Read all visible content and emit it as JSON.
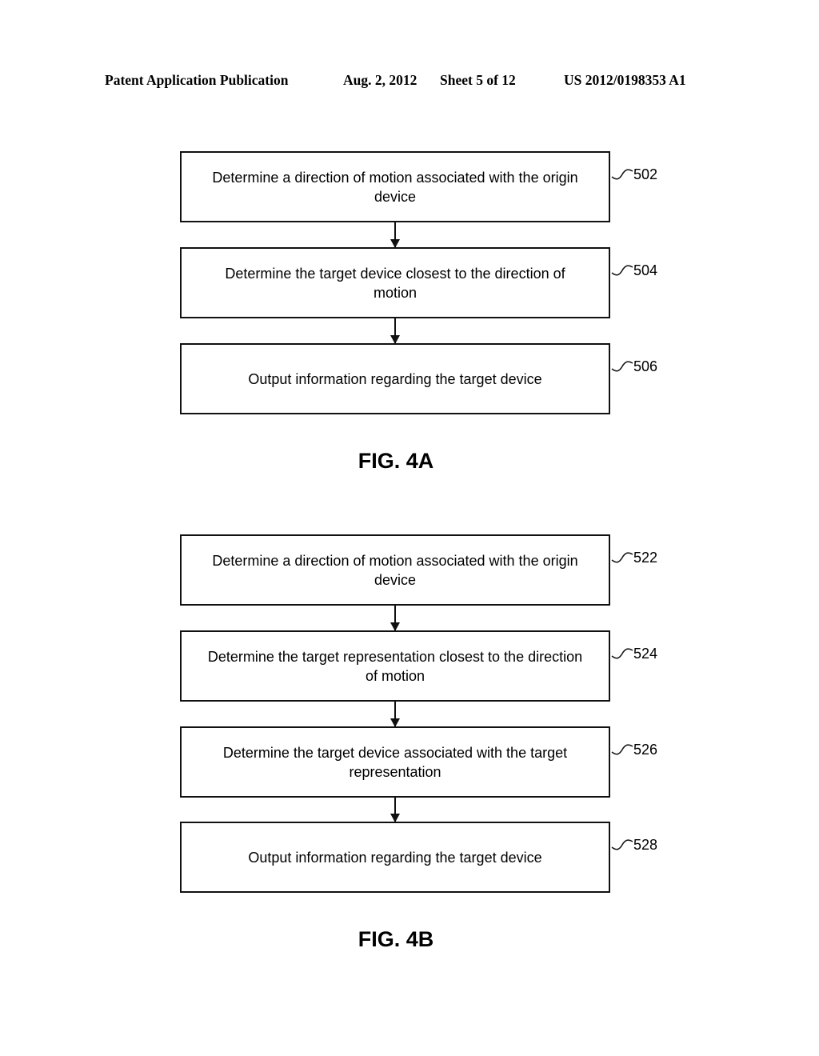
{
  "header": {
    "publication": "Patent Application Publication",
    "date": "Aug. 2, 2012",
    "sheet": "Sheet 5 of 12",
    "number": "US 2012/0198353 A1"
  },
  "figures": [
    {
      "label": "FIG. 4A",
      "steps": [
        {
          "ref": "502",
          "text": "Determine a direction of motion associated with the origin device"
        },
        {
          "ref": "504",
          "text": "Determine the target device closest to the direction of motion"
        },
        {
          "ref": "506",
          "text": "Output information regarding the target device"
        }
      ]
    },
    {
      "label": "FIG. 4B",
      "steps": [
        {
          "ref": "522",
          "text": "Determine a direction of motion associated with the origin device"
        },
        {
          "ref": "524",
          "text": "Determine the target representation closest to the direction of motion"
        },
        {
          "ref": "526",
          "text": "Determine the target device associated with the target representation"
        },
        {
          "ref": "528",
          "text": "Output information regarding the target device"
        }
      ]
    }
  ]
}
